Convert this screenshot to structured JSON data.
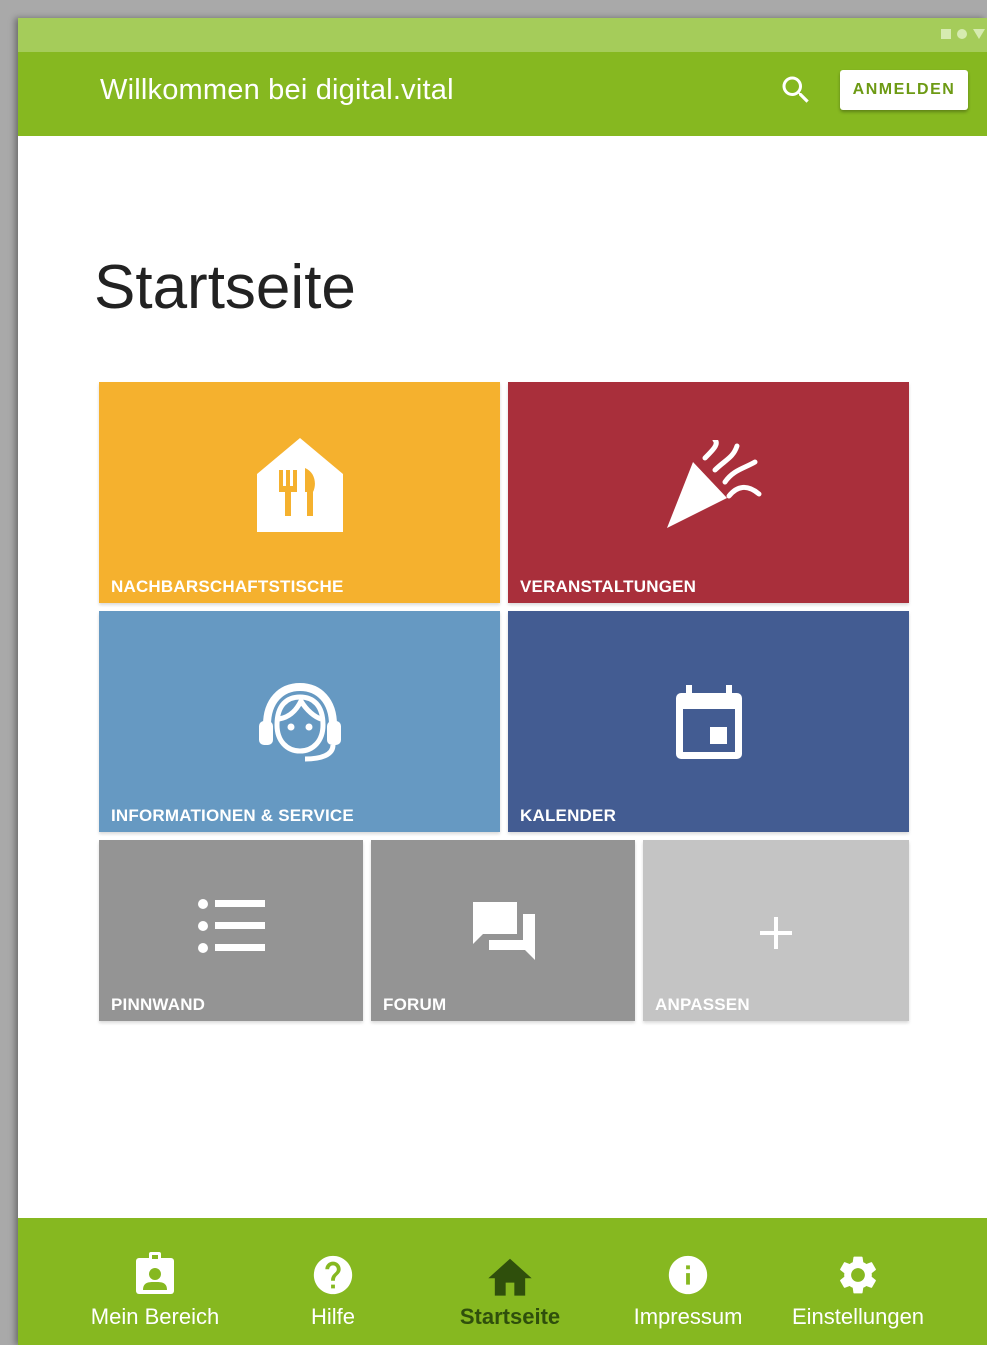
{
  "app_bar": {
    "title": "Willkommen bei digital.vital",
    "login_label": "ANMELDEN"
  },
  "page": {
    "title": "Startseite"
  },
  "tiles": [
    {
      "label": "NACHBARSCHAFTSTISCHE",
      "icon": "restaurant-house-icon",
      "color": "#f5b12e"
    },
    {
      "label": "VERANSTALTUNGEN",
      "icon": "party-popper-icon",
      "color": "#a92f3b"
    },
    {
      "label": "INFORMATIONEN & SERVICE",
      "icon": "support-agent-icon",
      "color": "#6699c2"
    },
    {
      "label": "KALENDER",
      "icon": "calendar-icon",
      "color": "#435c92"
    },
    {
      "label": "PINNWAND",
      "icon": "list-icon",
      "color": "#949494"
    },
    {
      "label": "FORUM",
      "icon": "forum-icon",
      "color": "#949494"
    },
    {
      "label": "ANPASSEN",
      "icon": "plus-icon",
      "color": "#c4c4c4"
    }
  ],
  "bottom_nav": [
    {
      "label": "Mein Bereich",
      "icon": "badge-icon"
    },
    {
      "label": "Hilfe",
      "icon": "help-icon"
    },
    {
      "label": "Startseite",
      "icon": "home-icon",
      "active": true
    },
    {
      "label": "Impressum",
      "icon": "info-icon"
    },
    {
      "label": "Einstellungen",
      "icon": "settings-icon"
    }
  ],
  "colors": {
    "primary": "#86b820",
    "status_bar": "#a5cc5a",
    "active_nav": "#2f4f0c"
  }
}
